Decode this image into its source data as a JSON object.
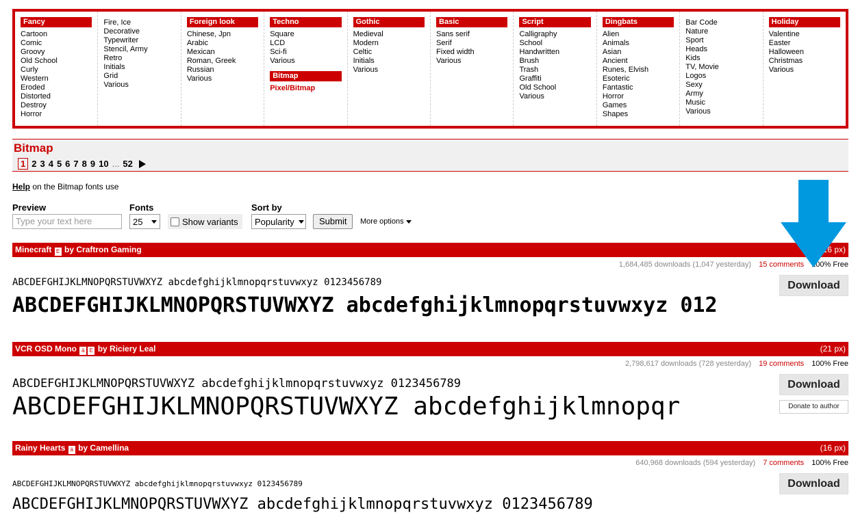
{
  "menu": {
    "columns": [
      {
        "heading": "Fancy",
        "items": [
          "Cartoon",
          "Comic",
          "Groovy",
          "Old School",
          "Curly",
          "Western",
          "Eroded",
          "Distorted",
          "Destroy",
          "Horror"
        ]
      },
      {
        "heading": "",
        "items": [
          "Fire, Ice",
          "Decorative",
          "Typewriter",
          "Stencil, Army",
          "Retro",
          "Initials",
          "Grid",
          "Various"
        ]
      },
      {
        "heading": "Foreign look",
        "items": [
          "Chinese, Jpn",
          "Arabic",
          "Mexican",
          "Roman, Greek",
          "Russian",
          "Various"
        ]
      },
      {
        "heading": "Techno",
        "items": [
          "Square",
          "LCD",
          "Sci-fi",
          "Various"
        ],
        "subheading": "Bitmap",
        "subitem": "Pixel/Bitmap"
      },
      {
        "heading": "Gothic",
        "items": [
          "Medieval",
          "Modern",
          "Celtic",
          "Initials",
          "Various"
        ]
      },
      {
        "heading": "Basic",
        "items": [
          "Sans serif",
          "Serif",
          "Fixed width",
          "Various"
        ]
      },
      {
        "heading": "Script",
        "items": [
          "Calligraphy",
          "School",
          "Handwritten",
          "Brush",
          "Trash",
          "Graffiti",
          "Old School",
          "Various"
        ]
      },
      {
        "heading": "Dingbats",
        "items": [
          "Alien",
          "Animals",
          "Asian",
          "Ancient",
          "Runes, Elvish",
          "Esoteric",
          "Fantastic",
          "Horror",
          "Games",
          "Shapes"
        ]
      },
      {
        "heading": "",
        "items": [
          "Bar Code",
          "Nature",
          "Sport",
          "Heads",
          "Kids",
          "TV, Movie",
          "Logos",
          "Sexy",
          "Army",
          "Music",
          "Various"
        ]
      },
      {
        "heading": "Holiday",
        "items": [
          "Valentine",
          "Easter",
          "Halloween",
          "Christmas",
          "Various"
        ]
      }
    ]
  },
  "page": {
    "title": "Bitmap",
    "pages": [
      "1",
      "2",
      "3",
      "4",
      "5",
      "6",
      "7",
      "8",
      "9",
      "10"
    ],
    "current_page": "1",
    "ellipsis": "...",
    "last_page": "52",
    "help_link": "Help",
    "help_rest": " on the Bitmap fonts use"
  },
  "filters": {
    "preview_label": "Preview",
    "preview_placeholder": "Type your text here",
    "fonts_label": "Fonts",
    "fonts_value": "25",
    "variants_label": "Show variants",
    "sort_label": "Sort by",
    "sort_value": "Popularity",
    "submit_label": "Submit",
    "more_options": "More options"
  },
  "fonts": [
    {
      "name": "Minecraft",
      "by": "by Craftron Gaming",
      "size": "(16 px)",
      "downloads": "1,684,485 downloads (1,047 yesterday)",
      "comments": "15 comments",
      "license": "100% Free",
      "sample_small": "ABCDEFGHIJKLMNOPQRSTUVWXYZ abcdefghijklmnopqrstuvwxyz 0123456789",
      "sample_big": "ABCDEFGHIJKLMNOPQRSTUVWXYZ abcdefghijklmnopqrstuvwxyz 012",
      "download": "Download"
    },
    {
      "name": "VCR OSD Mono",
      "by": "by Riciery Leal",
      "size": "(21 px)",
      "downloads": "2,798,617 downloads (728 yesterday)",
      "comments": "19 comments",
      "license": "100% Free",
      "sample_small": "ABCDEFGHIJKLMNOPQRSTUVWXYZ abcdefghijklmnopqrstuvwxyz 0123456789",
      "sample_big": "ABCDEFGHIJKLMNOPQRSTUVWXYZ abcdefghijklmnopqr",
      "download": "Download",
      "donate": "Donate to author"
    },
    {
      "name": "Rainy Hearts",
      "by": "by Camellina",
      "size": "(16 px)",
      "downloads": "640,968 downloads (594 yesterday)",
      "comments": "7 comments",
      "license": "100% Free",
      "sample_small": "ABCDEFGHIJKLMNOPQRSTUVWXYZ abcdefghijklmnopqrstuvwxyz 0123456789",
      "sample_big": "ABCDEFGHIJKLMNOPQRSTUVWXYZ abcdefghijklmnopqrstuvwxyz 0123456789",
      "download": "Download"
    }
  ],
  "colors": {
    "brand": "#cc0000",
    "arrow": "#0099e0",
    "button": "#e6e6e6"
  },
  "annotation": {
    "icon": "down-arrow-icon"
  }
}
